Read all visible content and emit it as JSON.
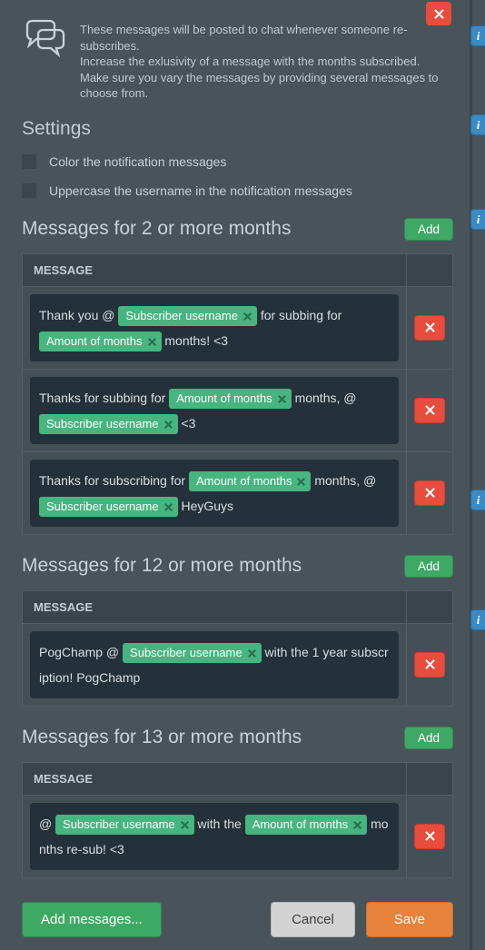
{
  "intro": {
    "line1": "These messages will be posted to chat whenever someone re-subscribes.",
    "line2": "Increase the exlusivity of a message with the months subscribed.",
    "line3": "Make sure you vary the messages by providing several messages to choose from."
  },
  "settings": {
    "heading": "Settings",
    "chk_color": "Color the notification messages",
    "chk_upper": "Uppercase the username in the notification messages"
  },
  "tokens": {
    "username": "Subscriber username",
    "months": "Amount of months"
  },
  "labels": {
    "message_header": "MESSAGE",
    "add": "Add",
    "add_messages": "Add messages...",
    "cancel": "Cancel",
    "save": "Save",
    "info_glyph": "i"
  },
  "sections": [
    {
      "title": "Messages for 2 or more months",
      "rows": [
        {
          "parts": [
            "Thank you @ ",
            {
              "token": "username"
            },
            " for subbing for ",
            {
              "token": "months"
            },
            " months! <3"
          ]
        },
        {
          "parts": [
            "Thanks for subbing for ",
            {
              "token": "months"
            },
            " months, @ ",
            {
              "token": "username"
            },
            " <3"
          ]
        },
        {
          "parts": [
            "Thanks for subscribing for ",
            {
              "token": "months"
            },
            " months, @ ",
            {
              "token": "username"
            },
            " HeyGuys"
          ]
        }
      ]
    },
    {
      "title": "Messages for 12 or more months",
      "rows": [
        {
          "parts": [
            "PogChamp @ ",
            {
              "token": "username"
            },
            " with the 1 year subscription! PogChamp"
          ]
        }
      ]
    },
    {
      "title": "Messages for 13 or more months",
      "rows": [
        {
          "parts": [
            "@ ",
            {
              "token": "username"
            },
            " with the ",
            {
              "token": "months"
            },
            " months re-sub! <3"
          ]
        }
      ]
    }
  ],
  "info_tab_positions": [
    28,
    126,
    230,
    539,
    671
  ]
}
